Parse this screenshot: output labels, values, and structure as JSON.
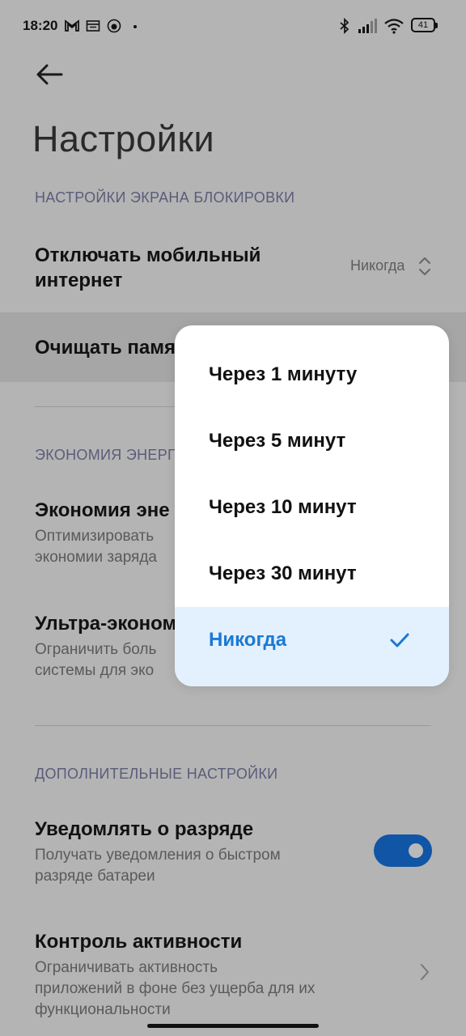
{
  "status_bar": {
    "time": "18:20",
    "battery": "41"
  },
  "header": {
    "title": "Настройки"
  },
  "sections": {
    "lock": "НАСТРОЙКИ ЭКРАНА БЛОКИРОВКИ",
    "energy": "ЭКОНОМИЯ ЭНЕРГ",
    "extra": "ДОПОЛНИТЕЛЬНЫЕ НАСТРОЙКИ"
  },
  "items": {
    "mobile_data": {
      "title_line1": "Отключать мобильный",
      "title_line2": "интернет",
      "value": "Никогда"
    },
    "clear_memory": {
      "title": "Очищать памя"
    },
    "energy_saving": {
      "title": "Экономия эне",
      "sub_line1": "Оптимизировать",
      "sub_line2": "экономии заряда"
    },
    "ultra_saving": {
      "title": "Ультра-эконом",
      "sub_line1": "Ограничить боль",
      "sub_line2": "системы для эко"
    },
    "notify_drain": {
      "title": "Уведомлять о разряде",
      "sub_line1": "Получать уведомления о быстром",
      "sub_line2": "разряде батареи",
      "toggle_on": true
    },
    "activity_control": {
      "title": "Контроль активности",
      "sub_line1": "Ограничивать активность",
      "sub_line2": "приложений в фоне без ущерба для их",
      "sub_line3": "функциональности"
    }
  },
  "popup": {
    "options": [
      "Через 1 минуту",
      "Через 5 минут",
      "Через 10 минут",
      "Через 30 минут",
      "Никогда"
    ],
    "selected": "Никогда"
  },
  "colors": {
    "accent": "#1a79d4",
    "toggle": "#1055a6",
    "selected_bg": "#e3f0fd"
  }
}
